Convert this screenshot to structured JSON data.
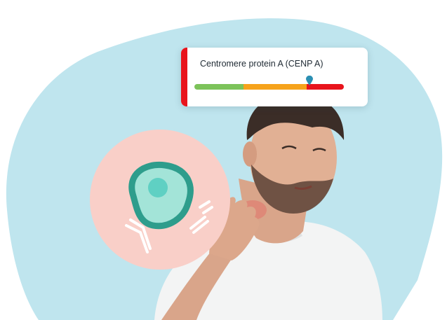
{
  "marker_card": {
    "title": "Centromere protein A (CENP A)",
    "accent_color": "#e8141c",
    "marker_icon": "location-pin-icon",
    "marker_color": "#2b8fb3",
    "marker_value_fraction": 0.77,
    "ranges": [
      {
        "color": "#7cc35a",
        "fraction": 0.33
      },
      {
        "color": "#f6a31b",
        "fraction": 0.42
      },
      {
        "color": "#e8141c",
        "fraction": 0.25
      }
    ]
  },
  "colors": {
    "background_blob": "#bfe5ee",
    "cell_badge": "#f9cfc8",
    "cell_outer": "#2e9d8c",
    "cell_inner": "#a3e4d8",
    "nucleus": "#5fd0c3",
    "antibody": "#ffffff"
  }
}
